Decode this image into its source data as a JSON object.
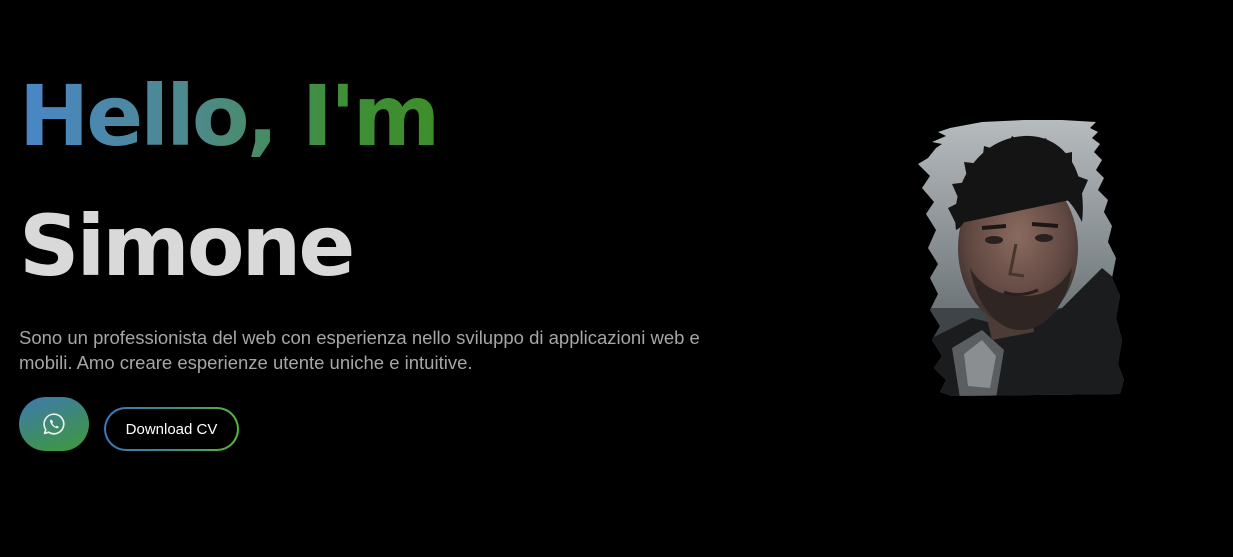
{
  "hero": {
    "greeting": "Hello, I'm",
    "name": "Simone",
    "intro": "Sono un professionista del web con esperienza nello sviluppo di applicazioni web e mobili. Amo creare esperienze utente uniche e intuitive.",
    "whatsapp_icon": "whatsapp-icon",
    "download_cv_label": "Download CV",
    "portrait_alt": "Simone"
  },
  "colors": {
    "background": "#000000",
    "gradient_start": "#4a86c8",
    "gradient_end": "#3d8e2a",
    "name_text": "#d9d9d9",
    "body_text": "#a6a6a6"
  }
}
